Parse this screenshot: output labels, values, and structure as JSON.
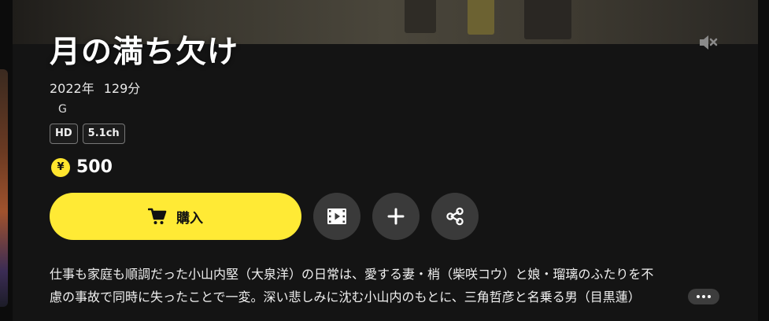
{
  "movie": {
    "title": "月の満ち欠け",
    "year": "2022年",
    "duration": "129分",
    "rating": "G",
    "badges": [
      "HD",
      "5.1ch"
    ]
  },
  "price": {
    "currency_symbol": "¥",
    "value": "500"
  },
  "actions": {
    "buy_label": "購入",
    "trailer_icon": "film-icon",
    "add_icon": "plus-icon",
    "share_icon": "share-icon"
  },
  "description": {
    "line1": "仕事も家庭も順調だった小山内堅（大泉洋）の日常は、愛する妻・梢（柴咲コウ）と娘・瑠璃のふたりを不",
    "line2": "慮の事故で同時に失ったことで一変。深い悲しみに沈む小山内のもとに、三角哲彦と名乗る男（目黒蓮）"
  },
  "colors": {
    "accent": "#ffea35",
    "background": "#141414",
    "circle_button": "#3a3a3a"
  }
}
